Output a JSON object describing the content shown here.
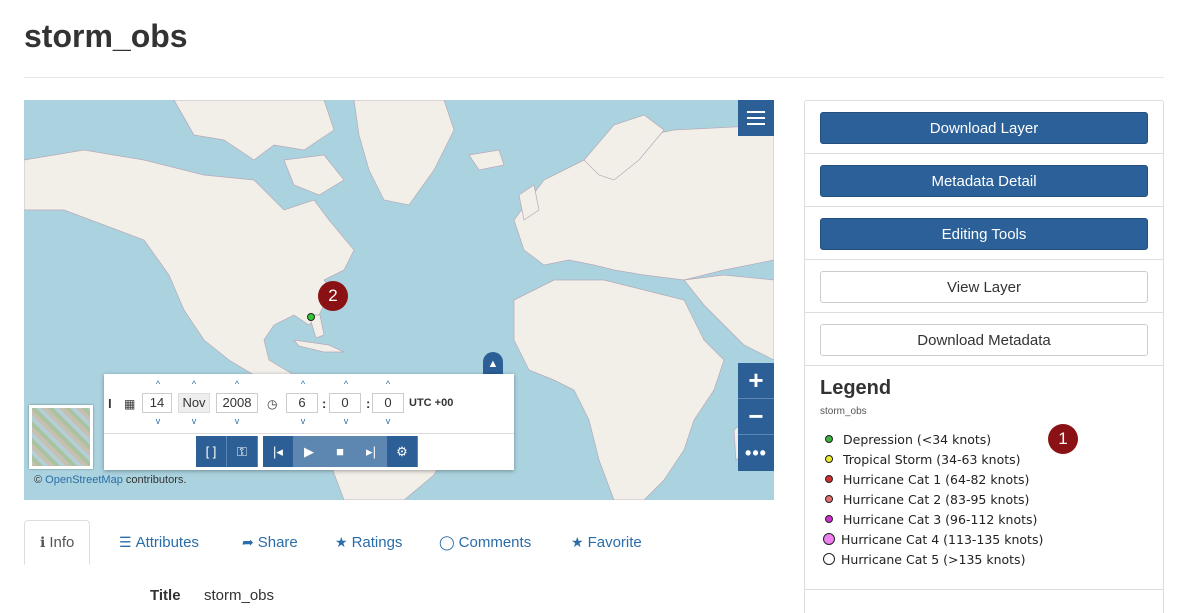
{
  "page": {
    "title": "storm_obs"
  },
  "map": {
    "attribution_prefix": "©",
    "attribution_link": "OpenStreetMap",
    "attribution_suffix": "contributors.",
    "zoom_in": "+",
    "zoom_out": "−",
    "more": "•••",
    "badge": "2"
  },
  "time_panel": {
    "day": "14",
    "month": "Nov",
    "year": "2008",
    "hour": "6",
    "minute": "0",
    "second": "0",
    "timezone": "UTC +00"
  },
  "sidebar": {
    "buttons": [
      {
        "label": "Download Layer",
        "style": "primary"
      },
      {
        "label": "Metadata Detail",
        "style": "primary"
      },
      {
        "label": "Editing Tools",
        "style": "primary"
      },
      {
        "label": "View Layer",
        "style": "default"
      },
      {
        "label": "Download Metadata",
        "style": "default"
      }
    ],
    "legend": {
      "title": "Legend",
      "layer": "storm_obs",
      "badge": "1",
      "items": [
        {
          "label": "Depression (<34 knots)",
          "color": "#3cb43c"
        },
        {
          "label": "Tropical Storm (34-63 knots)",
          "color": "#e8e830"
        },
        {
          "label": "Hurricane Cat 1 (64-82 knots)",
          "color": "#d03030"
        },
        {
          "label": "Hurricane Cat 2 (83-95 knots)",
          "color": "#e07070"
        },
        {
          "label": "Hurricane Cat 3 (96-112 knots)",
          "color": "#d030d0"
        },
        {
          "label": "Hurricane Cat 4 (113-135 knots)",
          "color": "#f080f0"
        },
        {
          "label": "Hurricane Cat 5 (>135 knots)",
          "color": "#ffffff"
        }
      ]
    }
  },
  "tabs": [
    {
      "label": "Info",
      "icon": "info-circle-icon"
    },
    {
      "label": "Attributes",
      "icon": "list-icon"
    },
    {
      "label": "Share",
      "icon": "share-icon"
    },
    {
      "label": "Ratings",
      "icon": "star-icon"
    },
    {
      "label": "Comments",
      "icon": "comment-icon"
    },
    {
      "label": "Favorite",
      "icon": "star-icon"
    }
  ],
  "info": {
    "title_label": "Title",
    "title_value": "storm_obs"
  }
}
